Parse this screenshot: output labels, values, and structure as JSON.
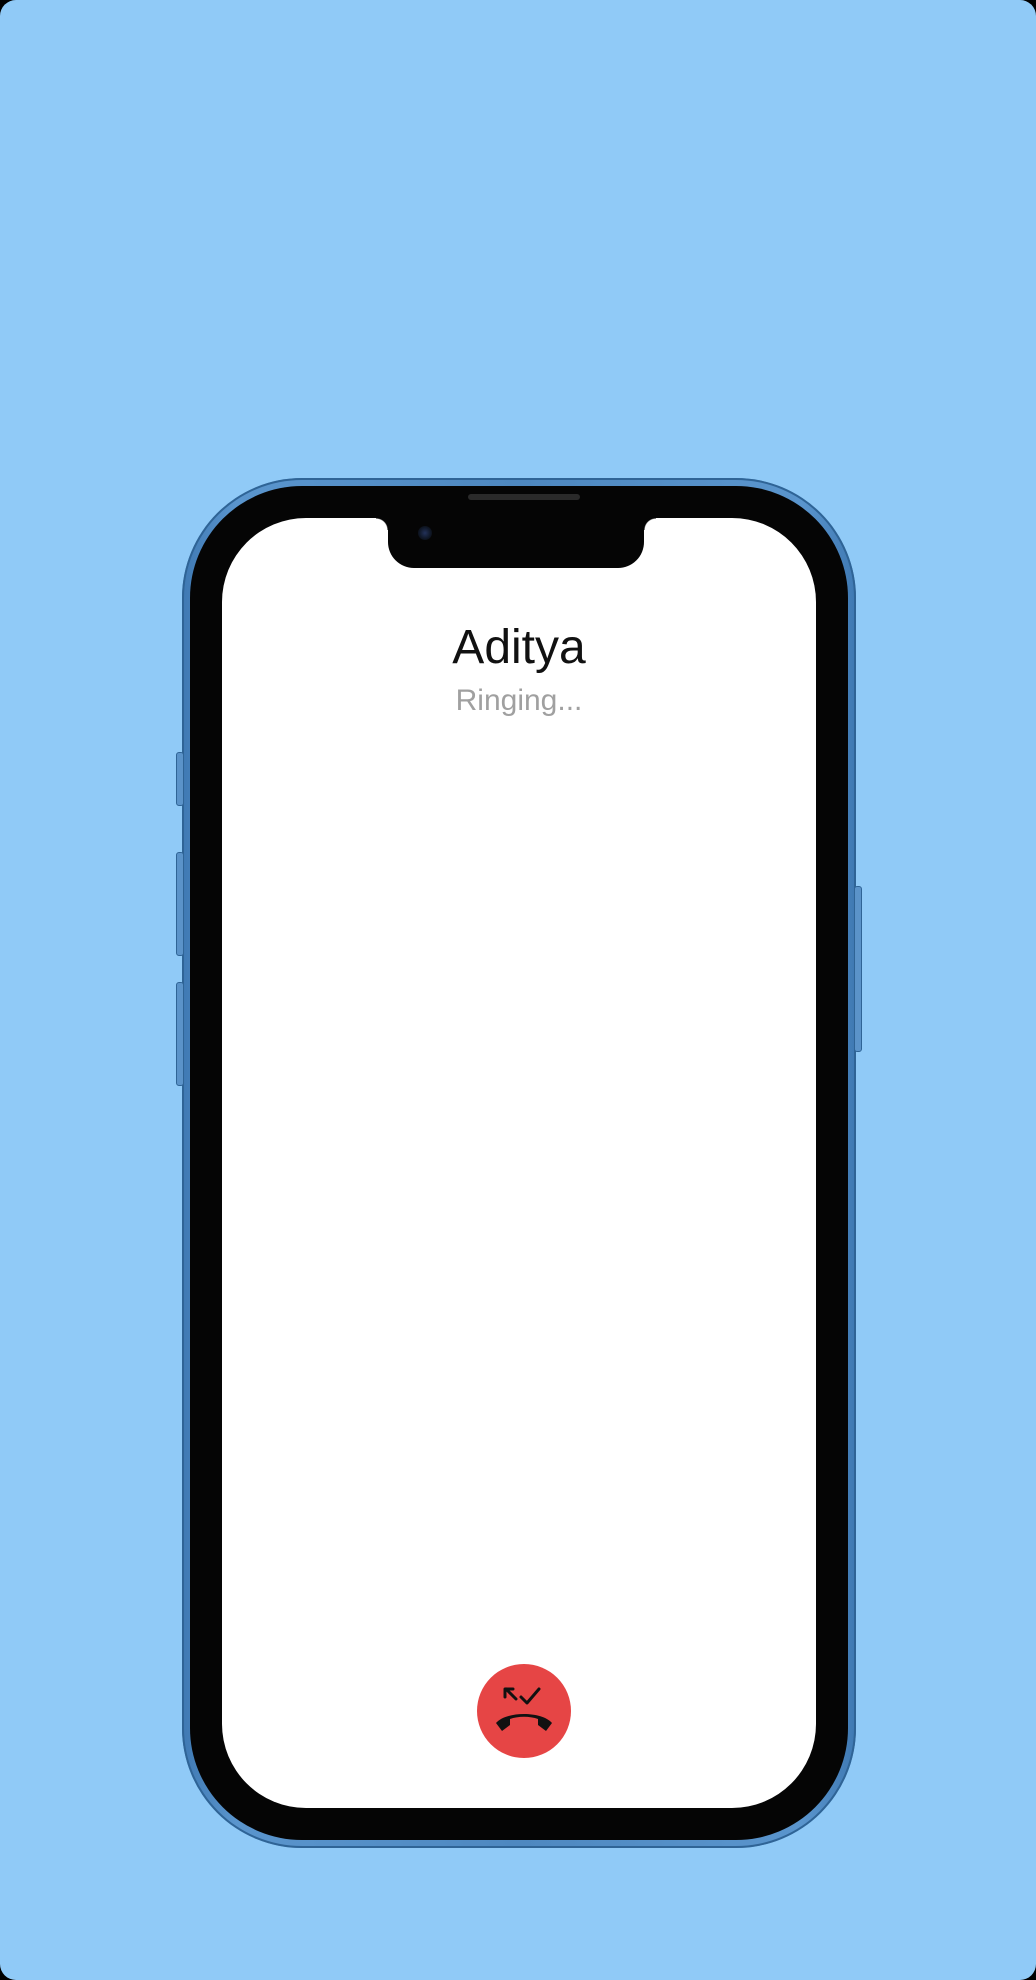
{
  "call": {
    "contact_name": "Aditya",
    "status": "Ringing..."
  },
  "controls": {
    "end_call_icon": "phone-hangup-icon"
  },
  "colors": {
    "background": "#90caf7",
    "end_call": "#e64545",
    "status_text": "#a0a0a0",
    "name_text": "#111111"
  }
}
